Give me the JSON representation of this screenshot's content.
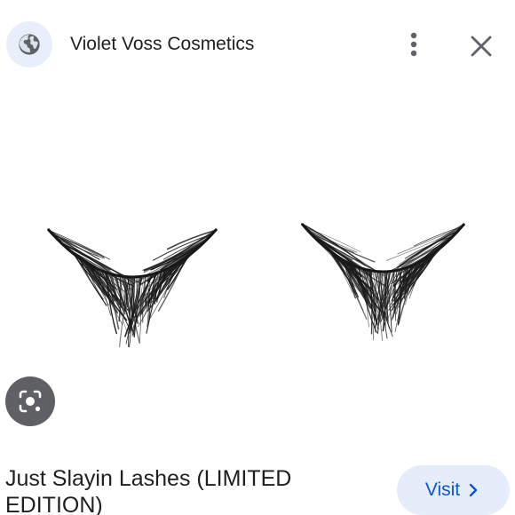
{
  "header": {
    "site_name": "Violet Voss Cosmetics",
    "site_icon": "globe-icon",
    "more_icon": "more-vertical-icon",
    "close_icon": "close-icon"
  },
  "image": {
    "subject_icon": "false-eyelashes-image"
  },
  "lens": {
    "icon": "lens-search-icon"
  },
  "product": {
    "title": "Just Slayin Lashes (LIMITED EDITION)"
  },
  "visit": {
    "label": "Visit",
    "icon": "chevron-right-icon"
  },
  "colors": {
    "accent": "#0b57d0",
    "visit_bg": "#e5edfb",
    "icon_bg": "#e8effa",
    "lens_bg": "#5f6063"
  }
}
